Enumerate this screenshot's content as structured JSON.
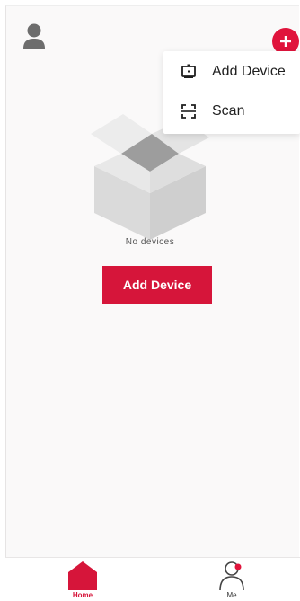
{
  "header": {
    "avatar_icon": "user-avatar-icon",
    "add_icon": "plus-circle-icon",
    "accent_color": "#e0143c"
  },
  "menu": {
    "items": [
      {
        "label": "Add Device",
        "icon": "device-frame-icon"
      },
      {
        "label": "Scan",
        "icon": "scan-frame-icon"
      }
    ]
  },
  "empty_state": {
    "icon": "empty-box-icon",
    "text": "No devices",
    "button_label": "Add Device"
  },
  "tabbar": {
    "tabs": [
      {
        "label": "Home",
        "icon": "home-icon",
        "active": true
      },
      {
        "label": "Me",
        "icon": "person-icon",
        "active": false,
        "badge_color": "#e0143c"
      }
    ]
  }
}
